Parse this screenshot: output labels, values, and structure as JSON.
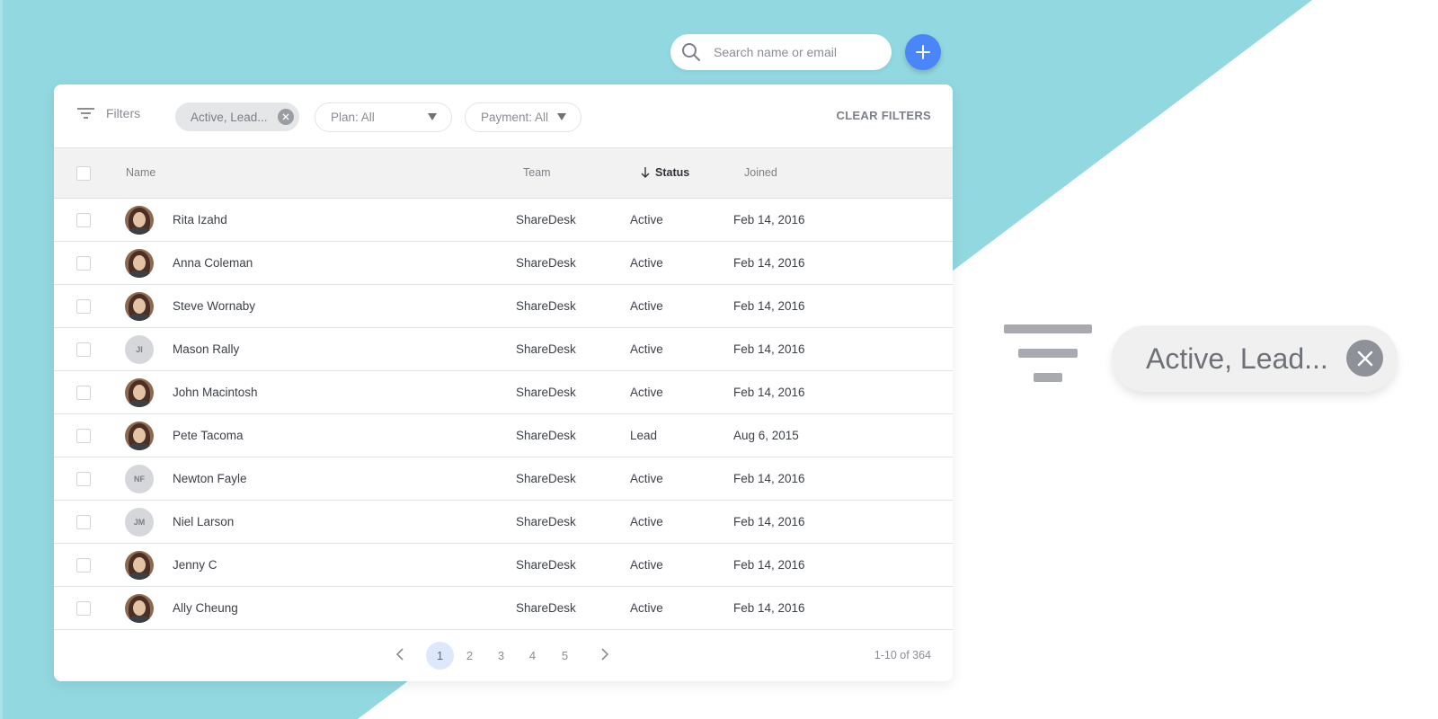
{
  "colors": {
    "background_teal": "#92d8e0",
    "accent_blue": "#4a86f7",
    "active_page_bg": "#dde9fb"
  },
  "search": {
    "placeholder": "Search name or email",
    "value": "",
    "icon": "search-icon"
  },
  "add_button": {
    "icon": "plus-icon"
  },
  "filters": {
    "label": "Filters",
    "icon": "filter-icon",
    "active_chip": {
      "label": "Active, Lead...",
      "close_icon": "close-icon"
    },
    "plan_select": {
      "label": "Plan: All",
      "icon": "caret-down-icon"
    },
    "payment_select": {
      "label": "Payment: All",
      "icon": "caret-down-icon"
    },
    "clear_label": "CLEAR FILTERS"
  },
  "table": {
    "columns": {
      "name": "Name",
      "team": "Team",
      "status": "Status",
      "joined": "Joined"
    },
    "sort": {
      "column": "Status",
      "direction": "descending",
      "icon": "arrow-down-icon"
    },
    "rows": [
      {
        "name": "Rita Izahd",
        "avatar": "photo",
        "initials": "",
        "team": "ShareDesk",
        "status": "Active",
        "joined": "Feb 14, 2016"
      },
      {
        "name": "Anna Coleman",
        "avatar": "photo",
        "initials": "",
        "team": "ShareDesk",
        "status": "Active",
        "joined": "Feb 14, 2016"
      },
      {
        "name": "Steve Wornaby",
        "avatar": "photo",
        "initials": "",
        "team": "ShareDesk",
        "status": "Active",
        "joined": "Feb 14, 2016"
      },
      {
        "name": "Mason Rally",
        "avatar": "initials",
        "initials": "JI",
        "team": "ShareDesk",
        "status": "Active",
        "joined": "Feb 14, 2016"
      },
      {
        "name": "John Macintosh",
        "avatar": "photo",
        "initials": "",
        "team": "ShareDesk",
        "status": "Active",
        "joined": "Feb 14, 2016"
      },
      {
        "name": "Pete Tacoma",
        "avatar": "photo",
        "initials": "",
        "team": "ShareDesk",
        "status": "Lead",
        "joined": "Aug 6, 2015"
      },
      {
        "name": "Newton Fayle",
        "avatar": "initials",
        "initials": "NF",
        "team": "ShareDesk",
        "status": "Active",
        "joined": "Feb 14, 2016"
      },
      {
        "name": "Niel Larson",
        "avatar": "initials",
        "initials": "JM",
        "team": "ShareDesk",
        "status": "Active",
        "joined": "Feb 14, 2016"
      },
      {
        "name": "Jenny C",
        "avatar": "photo",
        "initials": "",
        "team": "ShareDesk",
        "status": "Active",
        "joined": "Feb 14, 2016"
      },
      {
        "name": "Ally Cheung",
        "avatar": "photo",
        "initials": "",
        "team": "ShareDesk",
        "status": "Active",
        "joined": "Feb 14, 2016"
      }
    ]
  },
  "pagination": {
    "pages": [
      "1",
      "2",
      "3",
      "4",
      "5"
    ],
    "current": "1",
    "range_label": "1-10 of 364",
    "prev_icon": "chevron-left-icon",
    "next_icon": "chevron-right-icon"
  },
  "callout": {
    "chip_label": "Active, Lead...",
    "icon": "filter-icon",
    "close_icon": "close-icon"
  }
}
